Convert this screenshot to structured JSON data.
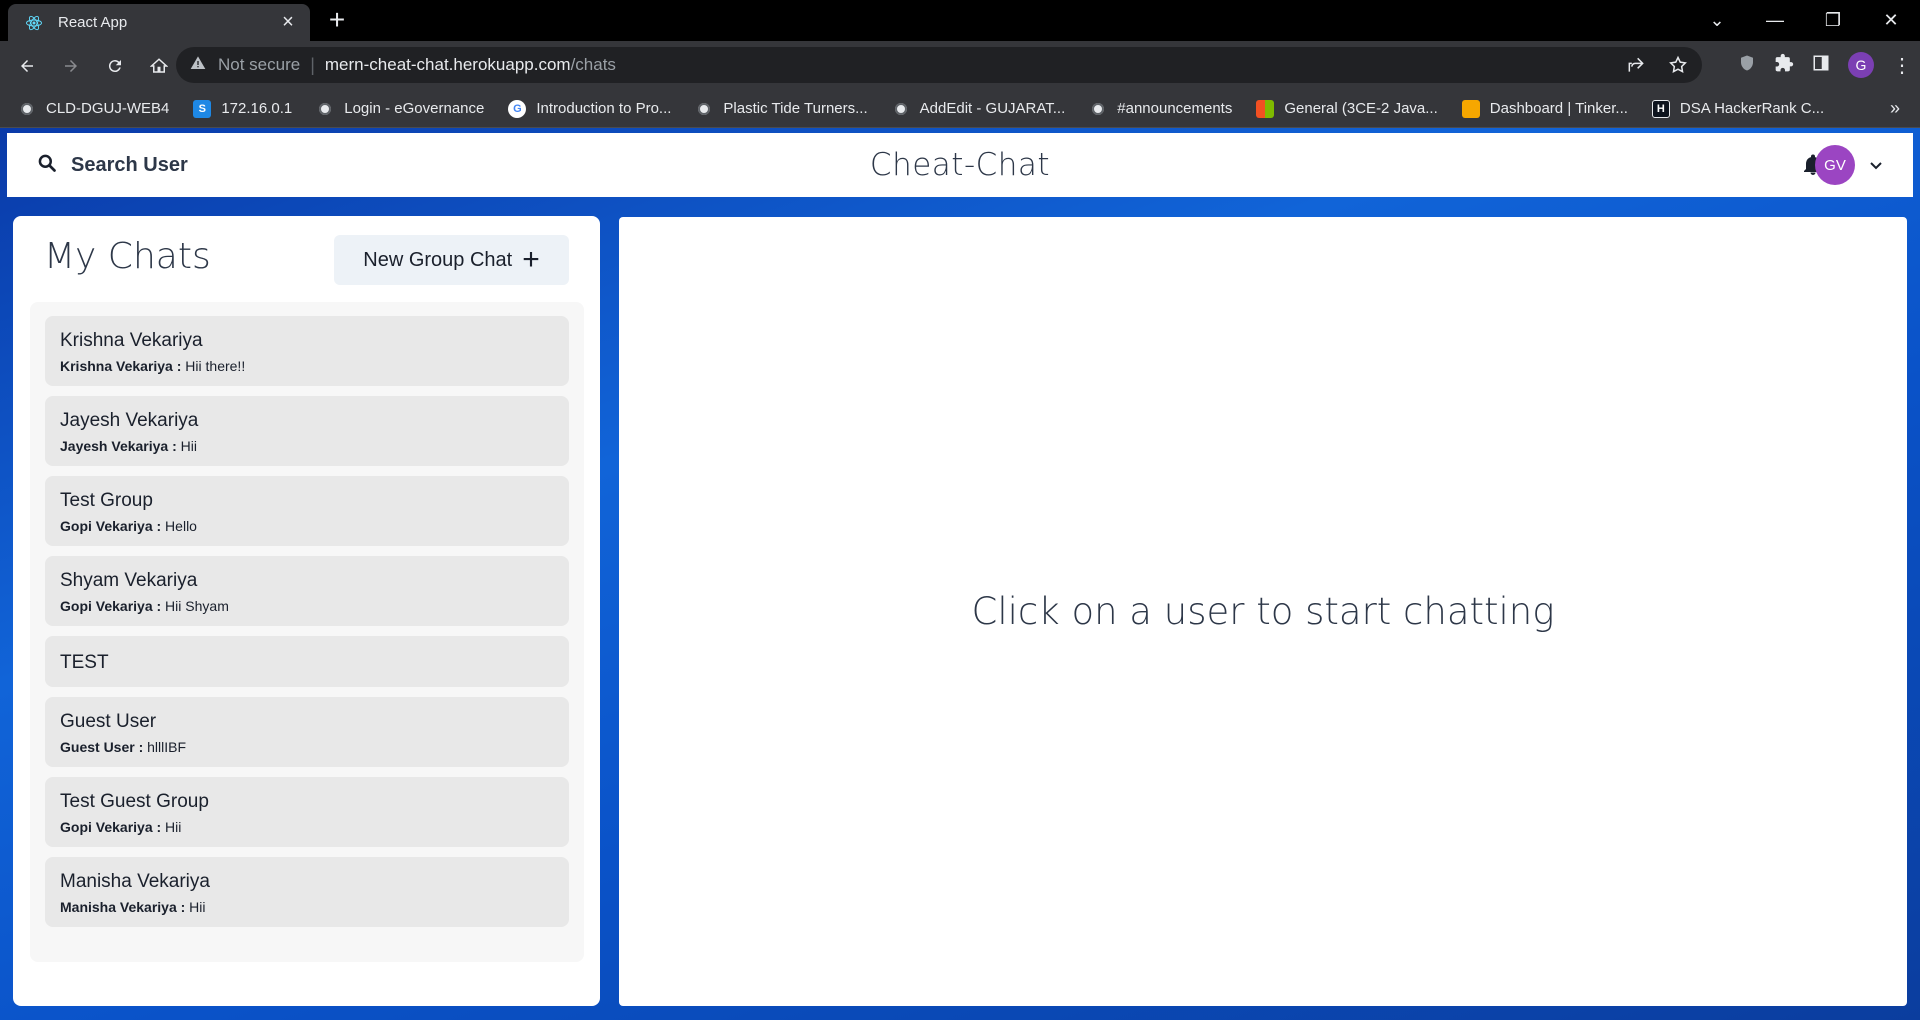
{
  "browser": {
    "tab_title": "React App",
    "url_security": "Not secure",
    "url_host": "mern-cheat-chat.herokuapp.com",
    "url_path": "/chats",
    "profile_initial": "G",
    "bookmarks": [
      {
        "label": "CLD-DGUJ-WEB4",
        "icon": "globe-icon",
        "color": "#5f6368"
      },
      {
        "label": "172.16.0.1",
        "icon": "s-logo-icon",
        "color": "#1e88e5"
      },
      {
        "label": "Login - eGovernance",
        "icon": "globe-icon",
        "color": "#5f6368"
      },
      {
        "label": "Introduction to Pro...",
        "icon": "google-icon",
        "color": "#ffffff"
      },
      {
        "label": "Plastic Tide Turners...",
        "icon": "globe-icon",
        "color": "#5f6368"
      },
      {
        "label": "AddEdit - GUJARAT...",
        "icon": "globe-icon",
        "color": "#5f6368"
      },
      {
        "label": "#announcements",
        "icon": "globe-icon",
        "color": "#5f6368"
      },
      {
        "label": "General (3CE-2 Java...",
        "icon": "microsoft-icon",
        "color": "#f25022"
      },
      {
        "label": "Dashboard | Tinker...",
        "icon": "tinkercad-icon",
        "color": "#f6a700"
      },
      {
        "label": "DSA HackerRank C...",
        "icon": "hackerrank-icon",
        "color": "#0e141e"
      }
    ]
  },
  "app": {
    "search_label": "Search User",
    "brand": "Cheat-Chat",
    "user_initials": "GV",
    "my_chats_title": "My Chats",
    "new_group_label": "New Group Chat",
    "empty_state": "Click on a user to start chatting",
    "chats": [
      {
        "name": "Krishna Vekariya",
        "sender": "Krishna Vekariya :",
        "message": " Hii there!!"
      },
      {
        "name": "Jayesh Vekariya",
        "sender": "Jayesh Vekariya :",
        "message": " Hii"
      },
      {
        "name": "Test Group",
        "sender": "Gopi Vekariya :",
        "message": " Hello"
      },
      {
        "name": "Shyam Vekariya",
        "sender": "Gopi Vekariya :",
        "message": " Hii Shyam"
      },
      {
        "name": "TEST",
        "sender": "",
        "message": ""
      },
      {
        "name": "Guest User",
        "sender": "Guest User :",
        "message": " hlllIBF"
      },
      {
        "name": "Test Guest Group",
        "sender": "Gopi Vekariya :",
        "message": " Hii"
      },
      {
        "name": "Manisha Vekariya",
        "sender": "Manisha Vekariya :",
        "message": " Hii"
      }
    ]
  }
}
